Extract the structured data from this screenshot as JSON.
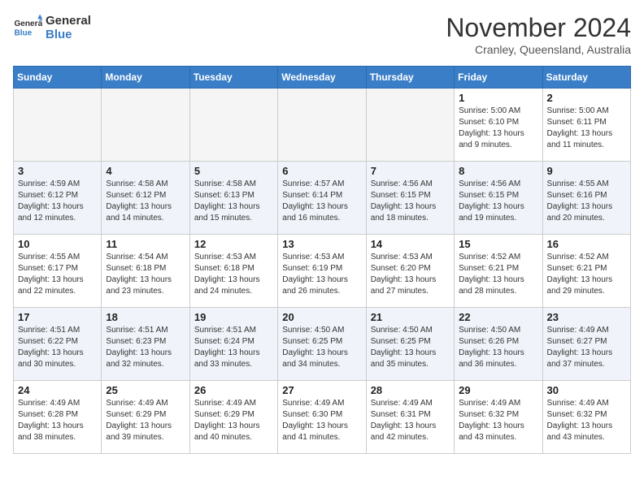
{
  "logo": {
    "text_general": "General",
    "text_blue": "Blue"
  },
  "title": "November 2024",
  "location": "Cranley, Queensland, Australia",
  "weekdays": [
    "Sunday",
    "Monday",
    "Tuesday",
    "Wednesday",
    "Thursday",
    "Friday",
    "Saturday"
  ],
  "weeks": [
    [
      {
        "day": null,
        "info": null
      },
      {
        "day": null,
        "info": null
      },
      {
        "day": null,
        "info": null
      },
      {
        "day": null,
        "info": null
      },
      {
        "day": null,
        "info": null
      },
      {
        "day": "1",
        "info": "Sunrise: 5:00 AM\nSunset: 6:10 PM\nDaylight: 13 hours\nand 9 minutes."
      },
      {
        "day": "2",
        "info": "Sunrise: 5:00 AM\nSunset: 6:11 PM\nDaylight: 13 hours\nand 11 minutes."
      }
    ],
    [
      {
        "day": "3",
        "info": "Sunrise: 4:59 AM\nSunset: 6:12 PM\nDaylight: 13 hours\nand 12 minutes."
      },
      {
        "day": "4",
        "info": "Sunrise: 4:58 AM\nSunset: 6:12 PM\nDaylight: 13 hours\nand 14 minutes."
      },
      {
        "day": "5",
        "info": "Sunrise: 4:58 AM\nSunset: 6:13 PM\nDaylight: 13 hours\nand 15 minutes."
      },
      {
        "day": "6",
        "info": "Sunrise: 4:57 AM\nSunset: 6:14 PM\nDaylight: 13 hours\nand 16 minutes."
      },
      {
        "day": "7",
        "info": "Sunrise: 4:56 AM\nSunset: 6:15 PM\nDaylight: 13 hours\nand 18 minutes."
      },
      {
        "day": "8",
        "info": "Sunrise: 4:56 AM\nSunset: 6:15 PM\nDaylight: 13 hours\nand 19 minutes."
      },
      {
        "day": "9",
        "info": "Sunrise: 4:55 AM\nSunset: 6:16 PM\nDaylight: 13 hours\nand 20 minutes."
      }
    ],
    [
      {
        "day": "10",
        "info": "Sunrise: 4:55 AM\nSunset: 6:17 PM\nDaylight: 13 hours\nand 22 minutes."
      },
      {
        "day": "11",
        "info": "Sunrise: 4:54 AM\nSunset: 6:18 PM\nDaylight: 13 hours\nand 23 minutes."
      },
      {
        "day": "12",
        "info": "Sunrise: 4:53 AM\nSunset: 6:18 PM\nDaylight: 13 hours\nand 24 minutes."
      },
      {
        "day": "13",
        "info": "Sunrise: 4:53 AM\nSunset: 6:19 PM\nDaylight: 13 hours\nand 26 minutes."
      },
      {
        "day": "14",
        "info": "Sunrise: 4:53 AM\nSunset: 6:20 PM\nDaylight: 13 hours\nand 27 minutes."
      },
      {
        "day": "15",
        "info": "Sunrise: 4:52 AM\nSunset: 6:21 PM\nDaylight: 13 hours\nand 28 minutes."
      },
      {
        "day": "16",
        "info": "Sunrise: 4:52 AM\nSunset: 6:21 PM\nDaylight: 13 hours\nand 29 minutes."
      }
    ],
    [
      {
        "day": "17",
        "info": "Sunrise: 4:51 AM\nSunset: 6:22 PM\nDaylight: 13 hours\nand 30 minutes."
      },
      {
        "day": "18",
        "info": "Sunrise: 4:51 AM\nSunset: 6:23 PM\nDaylight: 13 hours\nand 32 minutes."
      },
      {
        "day": "19",
        "info": "Sunrise: 4:51 AM\nSunset: 6:24 PM\nDaylight: 13 hours\nand 33 minutes."
      },
      {
        "day": "20",
        "info": "Sunrise: 4:50 AM\nSunset: 6:25 PM\nDaylight: 13 hours\nand 34 minutes."
      },
      {
        "day": "21",
        "info": "Sunrise: 4:50 AM\nSunset: 6:25 PM\nDaylight: 13 hours\nand 35 minutes."
      },
      {
        "day": "22",
        "info": "Sunrise: 4:50 AM\nSunset: 6:26 PM\nDaylight: 13 hours\nand 36 minutes."
      },
      {
        "day": "23",
        "info": "Sunrise: 4:49 AM\nSunset: 6:27 PM\nDaylight: 13 hours\nand 37 minutes."
      }
    ],
    [
      {
        "day": "24",
        "info": "Sunrise: 4:49 AM\nSunset: 6:28 PM\nDaylight: 13 hours\nand 38 minutes."
      },
      {
        "day": "25",
        "info": "Sunrise: 4:49 AM\nSunset: 6:29 PM\nDaylight: 13 hours\nand 39 minutes."
      },
      {
        "day": "26",
        "info": "Sunrise: 4:49 AM\nSunset: 6:29 PM\nDaylight: 13 hours\nand 40 minutes."
      },
      {
        "day": "27",
        "info": "Sunrise: 4:49 AM\nSunset: 6:30 PM\nDaylight: 13 hours\nand 41 minutes."
      },
      {
        "day": "28",
        "info": "Sunrise: 4:49 AM\nSunset: 6:31 PM\nDaylight: 13 hours\nand 42 minutes."
      },
      {
        "day": "29",
        "info": "Sunrise: 4:49 AM\nSunset: 6:32 PM\nDaylight: 13 hours\nand 43 minutes."
      },
      {
        "day": "30",
        "info": "Sunrise: 4:49 AM\nSunset: 6:32 PM\nDaylight: 13 hours\nand 43 minutes."
      }
    ]
  ]
}
